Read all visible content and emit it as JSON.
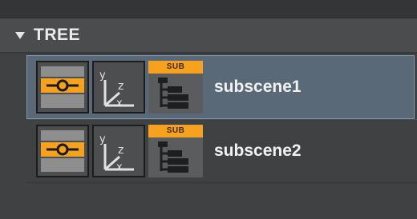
{
  "panel": {
    "title": "TREE",
    "collapse_icon": "chevron-down-icon"
  },
  "tree": {
    "items": [
      {
        "label": "subscene1",
        "selected": true,
        "badge": "SUB",
        "icons": [
          "visibility-toggle-icon",
          "axis-icon",
          "subscene-tree-icon"
        ]
      },
      {
        "label": "subscene2",
        "selected": false,
        "badge": "SUB",
        "icons": [
          "visibility-toggle-icon",
          "axis-icon",
          "subscene-tree-icon"
        ]
      }
    ]
  },
  "axis": {
    "y": "y",
    "z": "z",
    "x": "x"
  },
  "colors": {
    "accent_orange": "#f6a21f",
    "selection": "#596978",
    "panel_bg": "#3f4143"
  }
}
